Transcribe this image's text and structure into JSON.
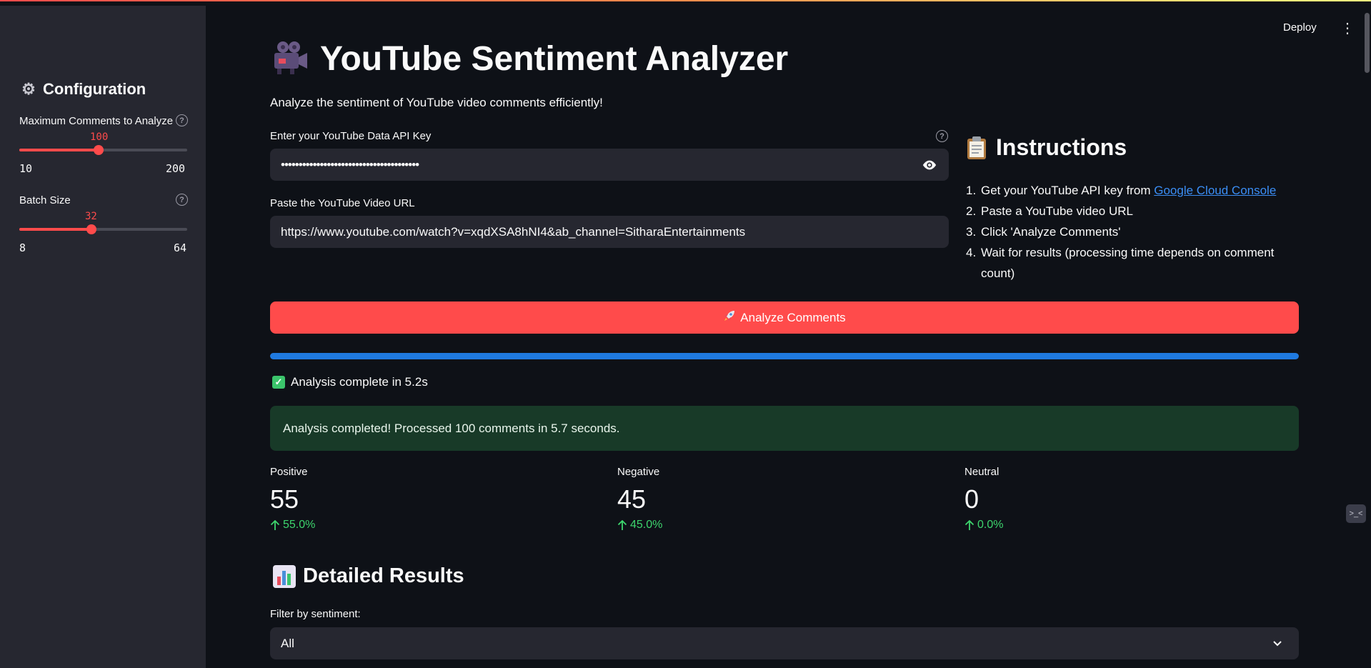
{
  "colors": {
    "accent": "#ff4b4b",
    "progress": "#1f7ae0",
    "success_bg": "#183a28",
    "delta": "#3dd56d",
    "link": "#3b8ef5"
  },
  "header": {
    "deploy_label": "Deploy"
  },
  "sidebar": {
    "title": "Configuration",
    "max_comments": {
      "label": "Maximum Comments to Analyze",
      "value": "100",
      "min": "10",
      "max": "200",
      "fraction": 0.4737
    },
    "batch_size": {
      "label": "Batch Size",
      "value": "32",
      "min": "8",
      "max": "64",
      "fraction": 0.4286
    }
  },
  "main": {
    "title": "YouTube Sentiment Analyzer",
    "subtitle": "Analyze the sentiment of YouTube video comments efficiently!",
    "api_key": {
      "label": "Enter your YouTube Data API Key",
      "value": "•••••••••••••••••••••••••••••••••••••••"
    },
    "video_url": {
      "label": "Paste the YouTube Video URL",
      "value": "https://www.youtube.com/watch?v=xqdXSA8hNI4&ab_channel=SitharaEntertainments"
    },
    "analyze_button": "Analyze Comments",
    "progress_fraction": 1.0,
    "status": "Analysis complete in 5.2s",
    "success_message": "Analysis completed! Processed 100 comments in 5.7 seconds.",
    "metrics": [
      {
        "label": "Positive",
        "value": "55",
        "delta": "55.0%"
      },
      {
        "label": "Negative",
        "value": "45",
        "delta": "45.0%"
      },
      {
        "label": "Neutral",
        "value": "0",
        "delta": "0.0%"
      }
    ],
    "detailed_title": "Detailed Results",
    "filter": {
      "label": "Filter by sentiment:",
      "value": "All"
    }
  },
  "instructions": {
    "title": "Instructions",
    "steps": [
      {
        "num": "1.",
        "text": "Get your YouTube API key from ",
        "link": "Google Cloud Console"
      },
      {
        "num": "2.",
        "text": "Paste a YouTube video URL"
      },
      {
        "num": "3.",
        "text": "Click 'Analyze Comments'"
      },
      {
        "num": "4.",
        "text": "Wait for results (processing time depends on comment count)"
      }
    ]
  }
}
